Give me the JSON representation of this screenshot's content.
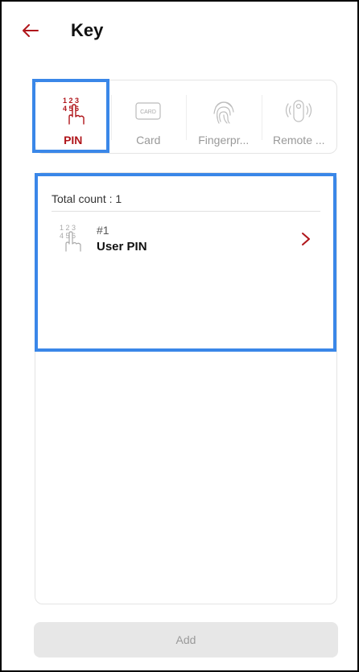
{
  "header": {
    "title": "Key",
    "back_icon": "arrow-left-icon",
    "accent_color": "#b0161b"
  },
  "tabs": [
    {
      "label": "PIN",
      "icon": "pin-keypad-icon",
      "active": true
    },
    {
      "label": "Card",
      "icon": "card-icon",
      "active": false
    },
    {
      "label": "Fingerpr...",
      "icon": "fingerprint-icon",
      "active": false
    },
    {
      "label": "Remote ...",
      "icon": "remote-icon",
      "active": false
    }
  ],
  "card_icon_text": "CARD",
  "list": {
    "total_count_label": "Total count : 1",
    "items": [
      {
        "number": "#1",
        "name": "User PIN",
        "icon": "pin-keypad-icon",
        "chevron": "chevron-right-icon"
      }
    ]
  },
  "footer": {
    "add_label": "Add"
  },
  "colors": {
    "highlight": "#3a87e8",
    "disabled_button": "#e7e7e7",
    "inactive_text": "#999999"
  }
}
